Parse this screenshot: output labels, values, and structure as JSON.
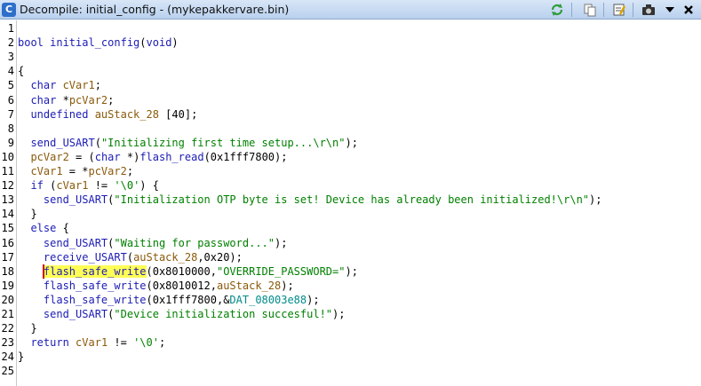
{
  "window": {
    "title": "Decompile: initial_config -  (mykepakkervare.bin)",
    "app_icon_label": "C"
  },
  "toolbar": {
    "buttons": [
      {
        "name": "refresh-icon",
        "color": "#2e9b3a"
      },
      {
        "name": "copy-icon",
        "color": "#666666"
      },
      {
        "name": "edit-function-icon",
        "color": "#444444"
      },
      {
        "name": "snapshot-icon",
        "color": "#333333"
      },
      {
        "name": "menu-dropdown-icon",
        "color": "#000000"
      },
      {
        "name": "close-icon",
        "color": "#000000"
      }
    ]
  },
  "code": {
    "highlighted_line": 18,
    "lines": [
      {
        "n": "1",
        "tokens": []
      },
      {
        "n": "2",
        "tokens": [
          {
            "t": "bool ",
            "c": "type"
          },
          {
            "t": "initial_config",
            "c": "fn"
          },
          {
            "t": "(",
            "c": "plain"
          },
          {
            "t": "void",
            "c": "type"
          },
          {
            "t": ")",
            "c": "plain"
          }
        ]
      },
      {
        "n": "3",
        "tokens": []
      },
      {
        "n": "4",
        "tokens": [
          {
            "t": "{",
            "c": "plain"
          }
        ]
      },
      {
        "n": "5",
        "tokens": [
          {
            "t": "  ",
            "c": "plain"
          },
          {
            "t": "char ",
            "c": "type"
          },
          {
            "t": "cVar1",
            "c": "var"
          },
          {
            "t": ";",
            "c": "plain"
          }
        ]
      },
      {
        "n": "6",
        "tokens": [
          {
            "t": "  ",
            "c": "plain"
          },
          {
            "t": "char ",
            "c": "type"
          },
          {
            "t": "*",
            "c": "plain"
          },
          {
            "t": "pcVar2",
            "c": "var"
          },
          {
            "t": ";",
            "c": "plain"
          }
        ]
      },
      {
        "n": "7",
        "tokens": [
          {
            "t": "  ",
            "c": "plain"
          },
          {
            "t": "undefined ",
            "c": "type"
          },
          {
            "t": "auStack_28",
            "c": "var"
          },
          {
            "t": " [40];",
            "c": "plain"
          }
        ]
      },
      {
        "n": "8",
        "tokens": []
      },
      {
        "n": "9",
        "tokens": [
          {
            "t": "  ",
            "c": "plain"
          },
          {
            "t": "send_USART",
            "c": "fn"
          },
          {
            "t": "(",
            "c": "plain"
          },
          {
            "t": "\"Initializing first time setup...\\r\\n\"",
            "c": "str"
          },
          {
            "t": ");",
            "c": "plain"
          }
        ]
      },
      {
        "n": "10",
        "tokens": [
          {
            "t": "  ",
            "c": "plain"
          },
          {
            "t": "pcVar2",
            "c": "var"
          },
          {
            "t": " = (",
            "c": "plain"
          },
          {
            "t": "char",
            "c": "type"
          },
          {
            "t": " *)",
            "c": "plain"
          },
          {
            "t": "flash_read",
            "c": "fn"
          },
          {
            "t": "(0x1fff7800);",
            "c": "plain"
          }
        ]
      },
      {
        "n": "11",
        "tokens": [
          {
            "t": "  ",
            "c": "plain"
          },
          {
            "t": "cVar1",
            "c": "var"
          },
          {
            "t": " = *",
            "c": "plain"
          },
          {
            "t": "pcVar2",
            "c": "var"
          },
          {
            "t": ";",
            "c": "plain"
          }
        ]
      },
      {
        "n": "12",
        "tokens": [
          {
            "t": "  ",
            "c": "plain"
          },
          {
            "t": "if",
            "c": "kw"
          },
          {
            "t": " (",
            "c": "plain"
          },
          {
            "t": "cVar1",
            "c": "var"
          },
          {
            "t": " != ",
            "c": "plain"
          },
          {
            "t": "'\\0'",
            "c": "str"
          },
          {
            "t": ") {",
            "c": "plain"
          }
        ]
      },
      {
        "n": "13",
        "tokens": [
          {
            "t": "    ",
            "c": "plain"
          },
          {
            "t": "send_USART",
            "c": "fn"
          },
          {
            "t": "(",
            "c": "plain"
          },
          {
            "t": "\"Initialization OTP byte is set! Device has already been initialized!\\r\\n\"",
            "c": "str"
          },
          {
            "t": ");",
            "c": "plain"
          }
        ]
      },
      {
        "n": "14",
        "tokens": [
          {
            "t": "  }",
            "c": "plain"
          }
        ]
      },
      {
        "n": "15",
        "tokens": [
          {
            "t": "  ",
            "c": "plain"
          },
          {
            "t": "else",
            "c": "kw"
          },
          {
            "t": " {",
            "c": "plain"
          }
        ]
      },
      {
        "n": "16",
        "tokens": [
          {
            "t": "    ",
            "c": "plain"
          },
          {
            "t": "send_USART",
            "c": "fn"
          },
          {
            "t": "(",
            "c": "plain"
          },
          {
            "t": "\"Waiting for password...\"",
            "c": "str"
          },
          {
            "t": ");",
            "c": "plain"
          }
        ]
      },
      {
        "n": "17",
        "tokens": [
          {
            "t": "    ",
            "c": "plain"
          },
          {
            "t": "receive_USART",
            "c": "fn"
          },
          {
            "t": "(",
            "c": "plain"
          },
          {
            "t": "auStack_28",
            "c": "var"
          },
          {
            "t": ",0x20);",
            "c": "plain"
          }
        ]
      },
      {
        "n": "18",
        "tokens": [
          {
            "t": "    ",
            "c": "plain"
          },
          {
            "t": "flash_safe_write",
            "c": "fn",
            "hl": true
          },
          {
            "t": "(0x8010000,",
            "c": "plain"
          },
          {
            "t": "\"OVERRIDE_PASSWORD=\"",
            "c": "str"
          },
          {
            "t": ");",
            "c": "plain"
          }
        ]
      },
      {
        "n": "19",
        "tokens": [
          {
            "t": "    ",
            "c": "plain"
          },
          {
            "t": "flash_safe_write",
            "c": "fn"
          },
          {
            "t": "(0x8010012,",
            "c": "plain"
          },
          {
            "t": "auStack_28",
            "c": "var"
          },
          {
            "t": ");",
            "c": "plain"
          }
        ]
      },
      {
        "n": "20",
        "tokens": [
          {
            "t": "    ",
            "c": "plain"
          },
          {
            "t": "flash_safe_write",
            "c": "fn"
          },
          {
            "t": "(0x1fff7800,&",
            "c": "plain"
          },
          {
            "t": "DAT_08003e88",
            "c": "global"
          },
          {
            "t": ");",
            "c": "plain"
          }
        ]
      },
      {
        "n": "21",
        "tokens": [
          {
            "t": "    ",
            "c": "plain"
          },
          {
            "t": "send_USART",
            "c": "fn"
          },
          {
            "t": "(",
            "c": "plain"
          },
          {
            "t": "\"Device initialization succesful!\"",
            "c": "str"
          },
          {
            "t": ");",
            "c": "plain"
          }
        ]
      },
      {
        "n": "22",
        "tokens": [
          {
            "t": "  }",
            "c": "plain"
          }
        ]
      },
      {
        "n": "23",
        "tokens": [
          {
            "t": "  ",
            "c": "plain"
          },
          {
            "t": "return",
            "c": "kw"
          },
          {
            "t": " ",
            "c": "plain"
          },
          {
            "t": "cVar1",
            "c": "var"
          },
          {
            "t": " != ",
            "c": "plain"
          },
          {
            "t": "'\\0'",
            "c": "str"
          },
          {
            "t": ";",
            "c": "plain"
          }
        ]
      },
      {
        "n": "24",
        "tokens": [
          {
            "t": "}",
            "c": "plain"
          }
        ]
      },
      {
        "n": "25",
        "tokens": []
      }
    ]
  }
}
